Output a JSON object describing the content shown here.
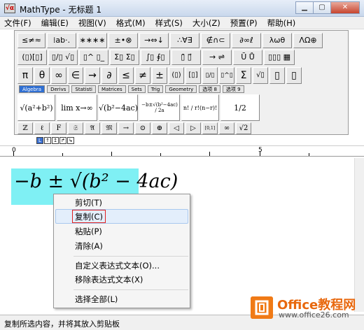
{
  "window": {
    "title": "MathType - 无标题 1"
  },
  "menu": [
    "文件(F)",
    "编辑(E)",
    "视图(V)",
    "格式(M)",
    "样式(S)",
    "大小(Z)",
    "预置(P)",
    "帮助(H)"
  ],
  "toolbar": {
    "row1": [
      "≤≠≈",
      "⁞ab·.",
      "∗∗∗∗",
      "±•⊗",
      "→⇔↓",
      "∴∀∃",
      "∉∩⊂",
      "∂∞ℓ",
      "λωθ",
      "ΛΩ⊕"
    ],
    "row2": [
      "(▯)[▯]",
      "▯/▯ √▯",
      "▯^ ▯_",
      "Σ▯ Σ▯",
      "∫▯ ∮▯",
      "▯̄ ▯⃗",
      "→ ⇌",
      "Ū Ů",
      "▯▯▯ ▦"
    ],
    "row3": [
      "π",
      "θ",
      "∞",
      "∈",
      "→",
      "∂",
      "≤",
      "≠",
      "±",
      "(▯)",
      "[▯]",
      "▯/▯",
      "▯^▯",
      "Σ",
      "√▯",
      "▯",
      "▯"
    ],
    "tabs": [
      "Algebra",
      "Derivs",
      "Statisti",
      "Matrices",
      "Sets",
      "Trig",
      "Geometry",
      "选项 8",
      "选项 9"
    ],
    "templates": [
      "√(a²+b²)",
      "lim x→∞",
      "√(b²−4ac)",
      "−b±√(b²−4ac) / 2a",
      "n! / r!(n−r)!",
      "1/2"
    ],
    "symbols": [
      "ℤ",
      "ℓ",
      "F",
      "𝔖",
      "𝔄",
      "𝔐",
      "→",
      "⊙",
      "⊕",
      "◁",
      "▷",
      "[0,1]",
      "∞",
      "√2"
    ]
  },
  "ruler": {
    "marks": [
      "0",
      "5"
    ]
  },
  "editor": {
    "equation": "−b ± √(b² − 4ac)"
  },
  "context_menu": {
    "items": [
      "剪切(T)",
      "复制(C)",
      "粘贴(P)",
      "清除(A)",
      "自定义表达式文本(O)...",
      "移除表达式文本(X)",
      "选择全部(L)"
    ],
    "highlighted": "复制(C)"
  },
  "status": "复制所选内容，并将其放入剪贴板",
  "watermark": {
    "title": "Office教程网",
    "url": "www.office26.com"
  }
}
